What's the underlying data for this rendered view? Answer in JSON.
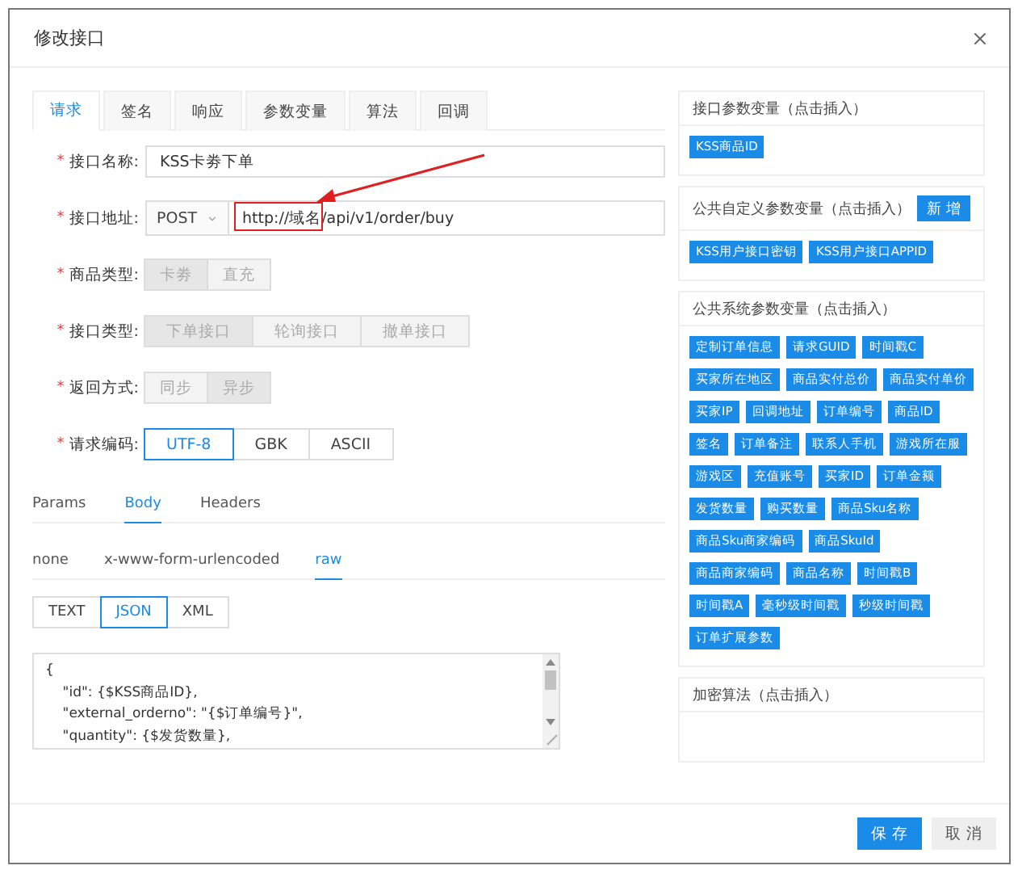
{
  "dialog": {
    "title": "修改接口"
  },
  "tabs": [
    {
      "label": "请求",
      "selected": true
    },
    {
      "label": "签名",
      "selected": false
    },
    {
      "label": "响应",
      "selected": false
    },
    {
      "label": "参数变量",
      "selected": false
    },
    {
      "label": "算法",
      "selected": false
    },
    {
      "label": "回调",
      "selected": false
    }
  ],
  "form": [
    {
      "kind": "text",
      "mark": "*",
      "label": "接口名称:",
      "value": "KSS卡劵下单"
    },
    {
      "kind": "url",
      "mark": "*",
      "label": "接口地址:",
      "method": "POST",
      "value": "http://域名/api/v1/order/buy",
      "highlighted": true
    },
    {
      "kind": "segmented",
      "mark": "*",
      "label": "商品类型:",
      "disabled": true,
      "options": [
        {
          "label": "卡劵",
          "selected": true
        },
        {
          "label": "直充",
          "selected": false
        }
      ]
    },
    {
      "kind": "segmented",
      "mark": "*",
      "label": "接口类型:",
      "disabled": true,
      "options": [
        {
          "label": "下单接口",
          "selected": true
        },
        {
          "label": "轮询接口",
          "selected": false
        },
        {
          "label": "撤单接口",
          "selected": false
        }
      ]
    },
    {
      "kind": "segmented",
      "mark": "*",
      "label": "返回方式:",
      "disabled": true,
      "options": [
        {
          "label": "同步",
          "selected": false
        },
        {
          "label": "异步",
          "selected": true
        }
      ]
    },
    {
      "kind": "segmented",
      "mark": "*",
      "label": "请求编码:",
      "disabled": false,
      "options": [
        {
          "label": "UTF-8",
          "selected": true
        },
        {
          "label": "GBK",
          "selected": false
        },
        {
          "label": "ASCII",
          "selected": false
        }
      ]
    }
  ],
  "body_tabs": [
    {
      "label": "Params",
      "selected": false
    },
    {
      "label": "Body",
      "selected": true
    },
    {
      "label": "Headers",
      "selected": false
    }
  ],
  "body_types": [
    {
      "label": "none",
      "selected": false
    },
    {
      "label": "x-www-form-urlencoded",
      "selected": false
    },
    {
      "label": "raw",
      "selected": true
    }
  ],
  "formats": [
    {
      "label": "TEXT",
      "selected": false
    },
    {
      "label": "JSON",
      "selected": true
    },
    {
      "label": "XML",
      "selected": false
    }
  ],
  "code_lines": [
    "{",
    "    \"id\": {$KSS商品ID},",
    "    \"external_orderno\": \"{$订单编号}\",",
    "    \"quantity\": {$发货数量},"
  ],
  "panels": [
    {
      "title": "接口参数变量（点击插入）",
      "tags": [
        "KSS商品ID"
      ]
    },
    {
      "title": "公共自定义参数变量（点击插入）",
      "action": "新 增",
      "tags": [
        "KSS用户接口密钥",
        "KSS用户接口APPID"
      ]
    },
    {
      "title": "公共系统参数变量（点击插入）",
      "tags": [
        "定制订单信息",
        "请求GUID",
        "时间戳C",
        "买家所在地区",
        "商品实付总价",
        "商品实付单价",
        "买家IP",
        "回调地址",
        "订单编号",
        "商品ID",
        "签名",
        "订单备注",
        "联系人手机",
        "游戏所在服",
        "游戏区",
        "充值账号",
        "买家ID",
        "订单金额",
        "发货数量",
        "购买数量",
        "商品Sku名称",
        "商品Sku商家编码",
        "商品SkuId",
        "商品商家编码",
        "商品名称",
        "时间戳B",
        "时间戳A",
        "毫秒级时间戳",
        "秒级时间戳",
        "订单扩展参数"
      ]
    },
    {
      "title": "加密算法（点击插入）"
    }
  ],
  "buttons": [
    {
      "label": "保 存",
      "kind": "primary"
    },
    {
      "label": "取 消",
      "kind": "default"
    }
  ]
}
